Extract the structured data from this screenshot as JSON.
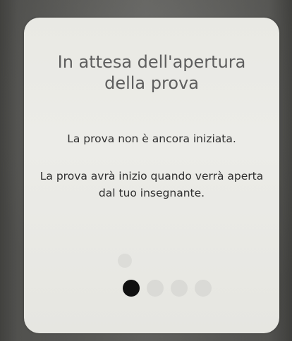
{
  "dialog": {
    "title": "In attesa dell'apertura della prova",
    "message_primary": "La prova non è ancora iniziata.",
    "message_secondary": "La prova avrà inizio quando verrà aperta dal tuo insegnante."
  },
  "progress_dots": {
    "count": 4,
    "active_index": 0,
    "active_color": "#111111",
    "inactive_color": "#dadad6"
  }
}
